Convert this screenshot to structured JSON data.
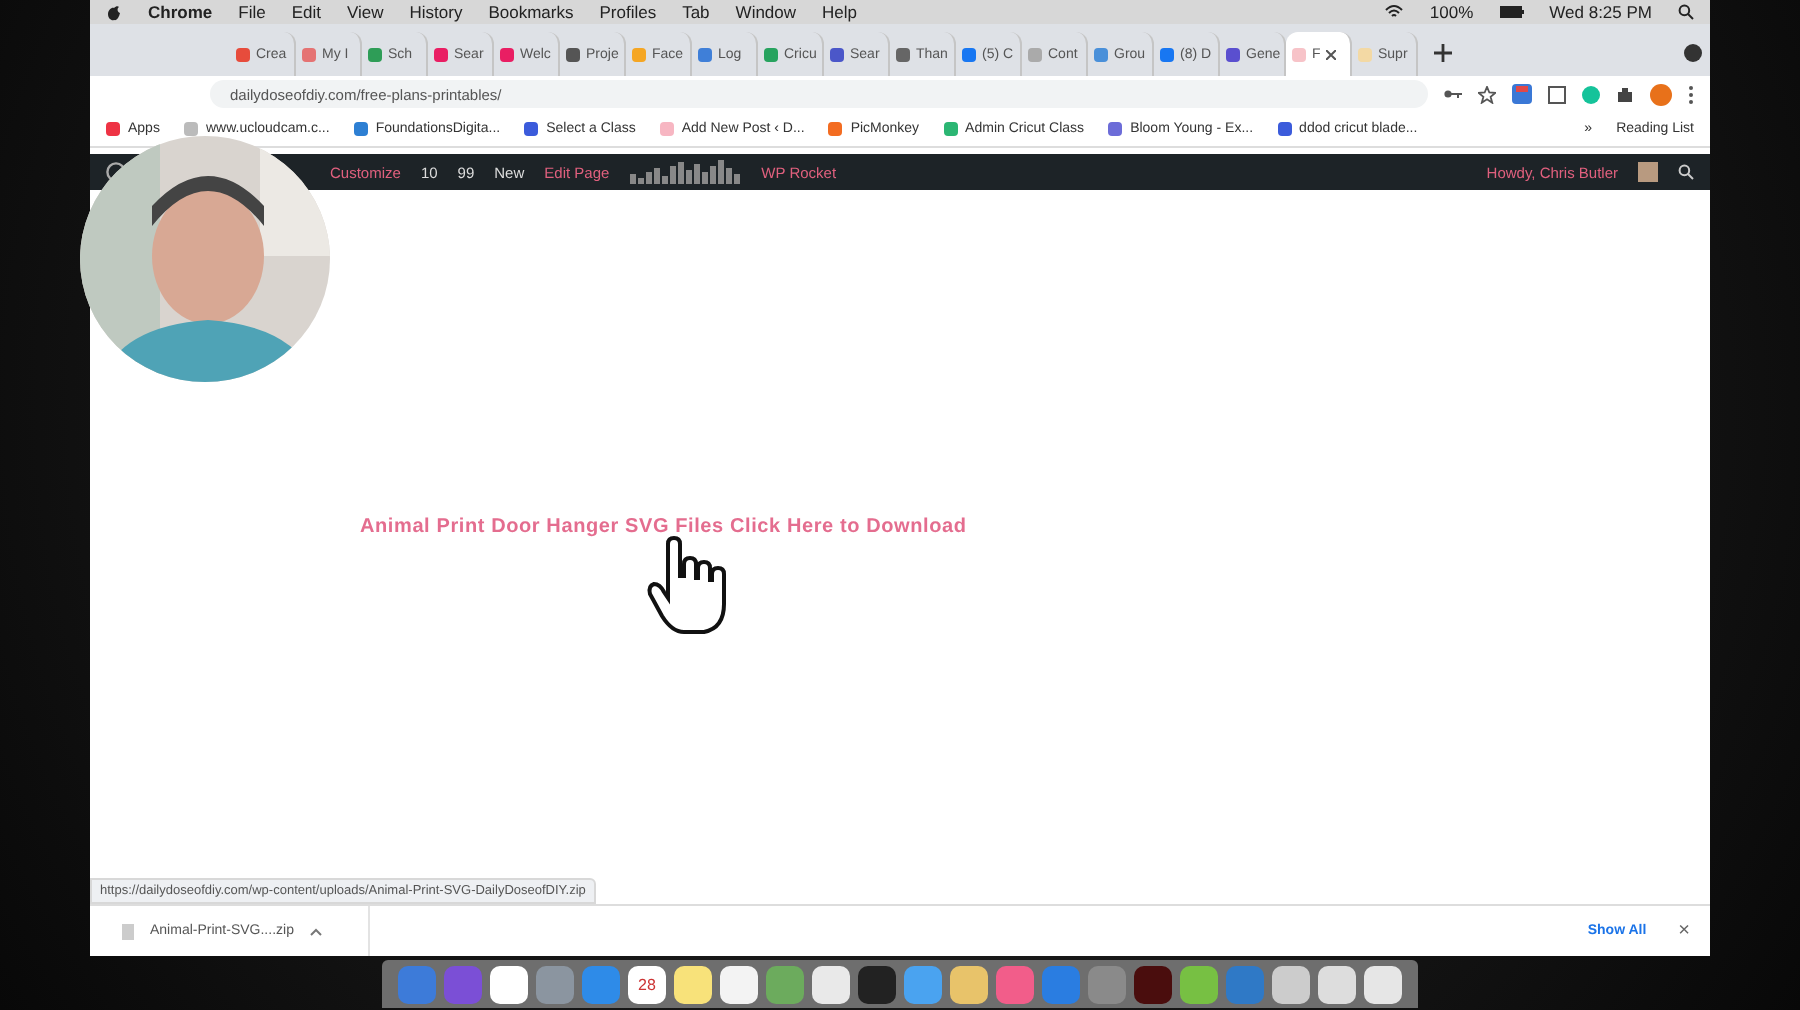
{
  "menu_bar": {
    "app": "Chrome",
    "items": [
      "File",
      "Edit",
      "View",
      "History",
      "Bookmarks",
      "Profiles",
      "Tab",
      "Window",
      "Help"
    ],
    "battery": "100%",
    "clock": "Wed 8:25 PM"
  },
  "tabs": [
    {
      "label": "Crea",
      "selected": false
    },
    {
      "label": "My I",
      "selected": false
    },
    {
      "label": "Sch",
      "selected": false
    },
    {
      "label": "Sear",
      "selected": false
    },
    {
      "label": "Welc",
      "selected": false
    },
    {
      "label": "Proje",
      "selected": false
    },
    {
      "label": "Face",
      "selected": false
    },
    {
      "label": "Log",
      "selected": false
    },
    {
      "label": "Cricu",
      "selected": false
    },
    {
      "label": "Sear",
      "selected": false
    },
    {
      "label": "Than",
      "selected": false
    },
    {
      "label": "(5) C",
      "selected": false
    },
    {
      "label": "Cont",
      "selected": false
    },
    {
      "label": "Grou",
      "selected": false
    },
    {
      "label": "(8) D",
      "selected": false
    },
    {
      "label": "Gene",
      "selected": false
    },
    {
      "label": "F",
      "selected": true
    },
    {
      "label": "Supr",
      "selected": false
    }
  ],
  "address_bar": {
    "value": "dailydoseofdiy.com/free-plans-printables/"
  },
  "bookmarks": [
    "Apps",
    "www.ucloudcam.c...",
    "FoundationsDigita...",
    "Select a Class",
    "Add New Post ‹ D...",
    "PicMonkey",
    "Admin Cricut Class",
    "Bloom Young - Ex...",
    "ddod cricut blade..."
  ],
  "bookmarks_more": "»",
  "reading_list": "Reading List",
  "admin_bar": {
    "customize": "Customize",
    "updates": "10",
    "comments": "99",
    "new": "New",
    "edit_page": "Edit Page",
    "plugin": "WP Rocket",
    "greeting": "Howdy, Chris Butler"
  },
  "content": {
    "link": "Animal Print Door Hanger SVG Files Click Here to Download"
  },
  "status_url": "https://dailydoseofdiy.com/wp-content/uploads/Animal-Print-SVG-DailyDoseofDIY.zip",
  "download_bar": {
    "file": "Animal-Print-SVG....zip",
    "show_all": "Show All",
    "close": "×"
  },
  "dock": {
    "date": "28"
  }
}
